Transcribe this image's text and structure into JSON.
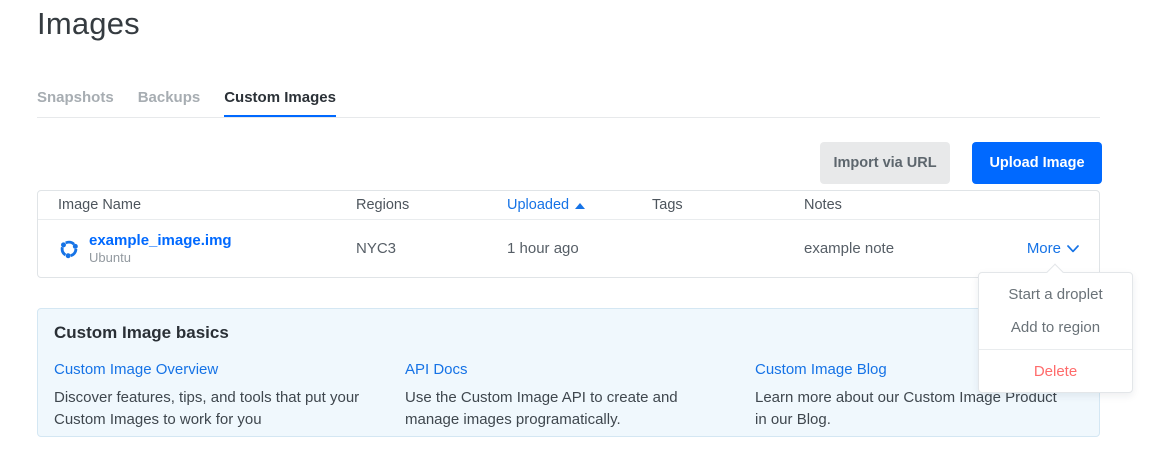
{
  "page": {
    "title": "Images"
  },
  "tabs": [
    {
      "label": "Snapshots",
      "active": false
    },
    {
      "label": "Backups",
      "active": false
    },
    {
      "label": "Custom Images",
      "active": true
    }
  ],
  "toolbar": {
    "import_button": "Import via URL",
    "upload_button": "Upload Image"
  },
  "table": {
    "columns": {
      "name": "Image Name",
      "regions": "Regions",
      "uploaded": "Uploaded",
      "tags": "Tags",
      "notes": "Notes"
    },
    "sort": {
      "column": "Uploaded",
      "direction": "asc"
    },
    "rows": [
      {
        "name": "example_image.img",
        "os": "Ubuntu",
        "os_icon": "ubuntu-logo-icon",
        "regions": "NYC3",
        "uploaded": "1 hour ago",
        "tags": "",
        "notes": "example note",
        "actions_label": "More"
      }
    ]
  },
  "dropdown": {
    "items": [
      {
        "label": "Start a droplet"
      },
      {
        "label": "Add to region"
      }
    ],
    "danger_item": {
      "label": "Delete"
    }
  },
  "info_panel": {
    "title": "Custom Image basics",
    "cards": [
      {
        "link": "Custom Image Overview",
        "text": "Discover features, tips, and tools that put your Custom Images to work for you"
      },
      {
        "link": "API Docs",
        "text": "Use the Custom Image API to create and manage images programatically."
      },
      {
        "link": "Custom Image Blog",
        "text": "Learn more about our Custom Image Product in our Blog."
      }
    ]
  },
  "colors": {
    "accent_blue": "#0069ff",
    "link_blue": "#1673e6",
    "danger_red": "#ff6b6b",
    "panel_bg": "#f0f8fd",
    "panel_border": "#d4e7f3",
    "inactive_tab": "#a7adb2"
  }
}
